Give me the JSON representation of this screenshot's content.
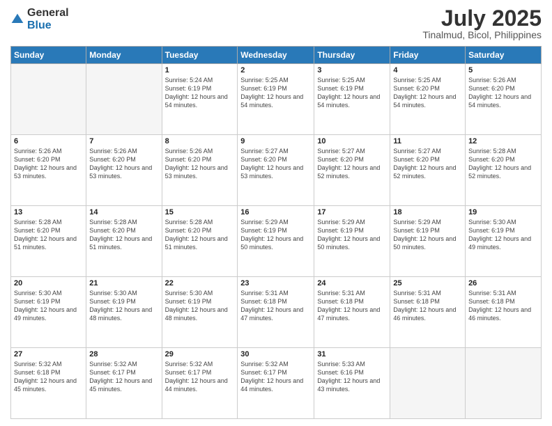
{
  "header": {
    "logo_general": "General",
    "logo_blue": "Blue",
    "month_title": "July 2025",
    "location": "Tinalmud, Bicol, Philippines"
  },
  "weekdays": [
    "Sunday",
    "Monday",
    "Tuesday",
    "Wednesday",
    "Thursday",
    "Friday",
    "Saturday"
  ],
  "weeks": [
    [
      {
        "day": "",
        "detail": ""
      },
      {
        "day": "",
        "detail": ""
      },
      {
        "day": "1",
        "detail": "Sunrise: 5:24 AM\nSunset: 6:19 PM\nDaylight: 12 hours and 54 minutes."
      },
      {
        "day": "2",
        "detail": "Sunrise: 5:25 AM\nSunset: 6:19 PM\nDaylight: 12 hours and 54 minutes."
      },
      {
        "day": "3",
        "detail": "Sunrise: 5:25 AM\nSunset: 6:19 PM\nDaylight: 12 hours and 54 minutes."
      },
      {
        "day": "4",
        "detail": "Sunrise: 5:25 AM\nSunset: 6:20 PM\nDaylight: 12 hours and 54 minutes."
      },
      {
        "day": "5",
        "detail": "Sunrise: 5:26 AM\nSunset: 6:20 PM\nDaylight: 12 hours and 54 minutes."
      }
    ],
    [
      {
        "day": "6",
        "detail": "Sunrise: 5:26 AM\nSunset: 6:20 PM\nDaylight: 12 hours and 53 minutes."
      },
      {
        "day": "7",
        "detail": "Sunrise: 5:26 AM\nSunset: 6:20 PM\nDaylight: 12 hours and 53 minutes."
      },
      {
        "day": "8",
        "detail": "Sunrise: 5:26 AM\nSunset: 6:20 PM\nDaylight: 12 hours and 53 minutes."
      },
      {
        "day": "9",
        "detail": "Sunrise: 5:27 AM\nSunset: 6:20 PM\nDaylight: 12 hours and 53 minutes."
      },
      {
        "day": "10",
        "detail": "Sunrise: 5:27 AM\nSunset: 6:20 PM\nDaylight: 12 hours and 52 minutes."
      },
      {
        "day": "11",
        "detail": "Sunrise: 5:27 AM\nSunset: 6:20 PM\nDaylight: 12 hours and 52 minutes."
      },
      {
        "day": "12",
        "detail": "Sunrise: 5:28 AM\nSunset: 6:20 PM\nDaylight: 12 hours and 52 minutes."
      }
    ],
    [
      {
        "day": "13",
        "detail": "Sunrise: 5:28 AM\nSunset: 6:20 PM\nDaylight: 12 hours and 51 minutes."
      },
      {
        "day": "14",
        "detail": "Sunrise: 5:28 AM\nSunset: 6:20 PM\nDaylight: 12 hours and 51 minutes."
      },
      {
        "day": "15",
        "detail": "Sunrise: 5:28 AM\nSunset: 6:20 PM\nDaylight: 12 hours and 51 minutes."
      },
      {
        "day": "16",
        "detail": "Sunrise: 5:29 AM\nSunset: 6:19 PM\nDaylight: 12 hours and 50 minutes."
      },
      {
        "day": "17",
        "detail": "Sunrise: 5:29 AM\nSunset: 6:19 PM\nDaylight: 12 hours and 50 minutes."
      },
      {
        "day": "18",
        "detail": "Sunrise: 5:29 AM\nSunset: 6:19 PM\nDaylight: 12 hours and 50 minutes."
      },
      {
        "day": "19",
        "detail": "Sunrise: 5:30 AM\nSunset: 6:19 PM\nDaylight: 12 hours and 49 minutes."
      }
    ],
    [
      {
        "day": "20",
        "detail": "Sunrise: 5:30 AM\nSunset: 6:19 PM\nDaylight: 12 hours and 49 minutes."
      },
      {
        "day": "21",
        "detail": "Sunrise: 5:30 AM\nSunset: 6:19 PM\nDaylight: 12 hours and 48 minutes."
      },
      {
        "day": "22",
        "detail": "Sunrise: 5:30 AM\nSunset: 6:19 PM\nDaylight: 12 hours and 48 minutes."
      },
      {
        "day": "23",
        "detail": "Sunrise: 5:31 AM\nSunset: 6:18 PM\nDaylight: 12 hours and 47 minutes."
      },
      {
        "day": "24",
        "detail": "Sunrise: 5:31 AM\nSunset: 6:18 PM\nDaylight: 12 hours and 47 minutes."
      },
      {
        "day": "25",
        "detail": "Sunrise: 5:31 AM\nSunset: 6:18 PM\nDaylight: 12 hours and 46 minutes."
      },
      {
        "day": "26",
        "detail": "Sunrise: 5:31 AM\nSunset: 6:18 PM\nDaylight: 12 hours and 46 minutes."
      }
    ],
    [
      {
        "day": "27",
        "detail": "Sunrise: 5:32 AM\nSunset: 6:18 PM\nDaylight: 12 hours and 45 minutes."
      },
      {
        "day": "28",
        "detail": "Sunrise: 5:32 AM\nSunset: 6:17 PM\nDaylight: 12 hours and 45 minutes."
      },
      {
        "day": "29",
        "detail": "Sunrise: 5:32 AM\nSunset: 6:17 PM\nDaylight: 12 hours and 44 minutes."
      },
      {
        "day": "30",
        "detail": "Sunrise: 5:32 AM\nSunset: 6:17 PM\nDaylight: 12 hours and 44 minutes."
      },
      {
        "day": "31",
        "detail": "Sunrise: 5:33 AM\nSunset: 6:16 PM\nDaylight: 12 hours and 43 minutes."
      },
      {
        "day": "",
        "detail": ""
      },
      {
        "day": "",
        "detail": ""
      }
    ]
  ]
}
